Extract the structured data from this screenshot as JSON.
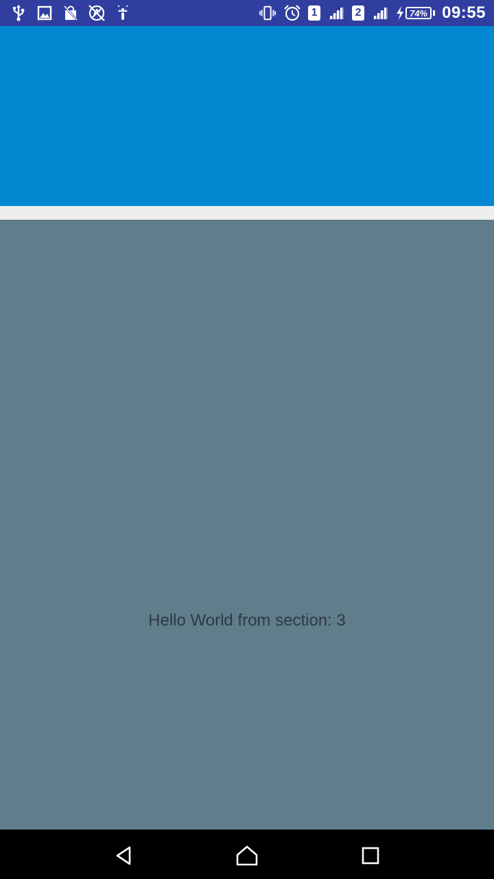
{
  "status_bar": {
    "left_icons": [
      "usb-icon",
      "image-icon",
      "shopping-bag-off-icon",
      "no-location-icon",
      "android-icon"
    ],
    "right_icons": [
      "vibrate-icon",
      "alarm-icon"
    ],
    "sim1_label": "1",
    "sim2_label": "2",
    "battery_percent": "74%",
    "battery_charging": true,
    "time": "09:55",
    "background_color": "#303f9f"
  },
  "header": {
    "background_color": "#0288d1"
  },
  "section": {
    "label": "Hello World from section: 3",
    "background_color": "#607d8b"
  },
  "nav_bar": {
    "buttons": [
      "back-icon",
      "home-icon",
      "recents-icon"
    ]
  }
}
